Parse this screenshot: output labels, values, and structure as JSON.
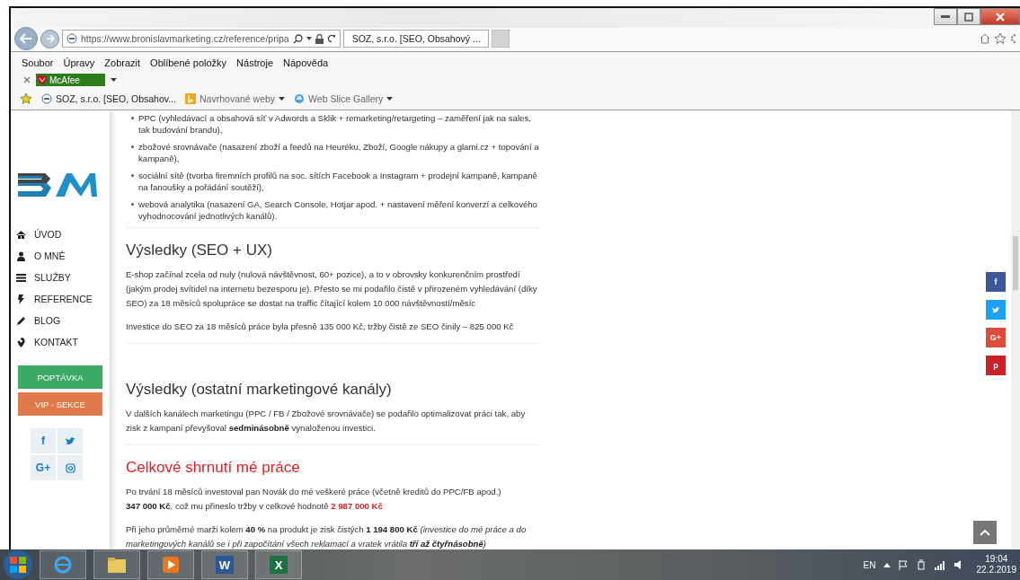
{
  "browser": {
    "url": "https://www.bronislavmarketing.cz/reference/pripa",
    "tab": {
      "title": "SOZ, s.r.o. [SEO, Obsahový ...",
      "selected": true
    },
    "menu": [
      "Soubor",
      "Úpravy",
      "Zobrazit",
      "Oblíbené položky",
      "Nástroje",
      "Nápověda"
    ],
    "toolbar_label": "McAfee",
    "favorites": [
      {
        "label": "SOZ, s.r.o. [SEO, Obsahov...",
        "kind": "site"
      },
      {
        "label": "Navrhované weby",
        "kind": "bing"
      },
      {
        "label": "Web Slice Gallery",
        "kind": "ie"
      }
    ]
  },
  "sidebar": {
    "nav": [
      {
        "label": "ÚVOD",
        "kind": "home"
      },
      {
        "label": "O MNĚ",
        "kind": "user"
      },
      {
        "label": "SLUŽBY",
        "kind": "list"
      },
      {
        "label": "REFERENCE",
        "kind": "bolt"
      },
      {
        "label": "BLOG",
        "kind": "pencil"
      },
      {
        "label": "KONTAKT",
        "kind": "pin"
      }
    ],
    "buttons": [
      {
        "label": "POPTÁVKA",
        "color": "#3aaa64"
      },
      {
        "label": "VIP - SEKCE",
        "color": "#e07a4a"
      }
    ],
    "social": [
      {
        "kind": "facebook",
        "glyph": "f"
      },
      {
        "kind": "twitter"
      },
      {
        "kind": "google",
        "glyph": "G+"
      },
      {
        "kind": "instagram"
      }
    ]
  },
  "content": [
    {
      "kind": "bullets",
      "items": [
        "PPC (vyhledávací a obsahová síť v Adwords a Sklik + remarketing/retargeting – zaměření jak na sales, tak budování brandu),",
        "zbožové srovnávače (nasazení zboží  a feedů na Heuréku, Zboží, Google nákupy a glami.cz + topování a kampaně),",
        "sociální sítě (tvorba firemních profilů na soc. sítích Facebook a Instagram + prodejní kampaně, kampaně na fanoušky a pořádání soutěží),",
        "webová analytika (nasazení GA, Search Console, Hotjar apod. + nastavení měření konverzí a celkového vyhodnocování jednotlivých kanálů)."
      ]
    },
    {
      "kind": "divider"
    },
    {
      "kind": "heading",
      "text": "Výsledky (SEO + UX)"
    },
    {
      "kind": "para",
      "text": "E-shop začínal zcela od nuly (nulová návštěvnost, 60+ pozice), a to v obrovsky konkurenčním prostředí (jakým prodej svítidel na internetu bezesporu je). Přesto se mi podařilo čistě v přirozeném vyhledávání (díky SEO) za 18 měsíců spolupráce se dostat na traffic čítající kolem 10 000 návštěvností/měsíc"
    },
    {
      "kind": "para",
      "text": "Investice do SEO za 18 měsíců práce byla přesně 135 000 Kč, tržby čistě ze SEO činily – 825 000 Kč"
    },
    {
      "kind": "divider"
    },
    {
      "kind": "spacer"
    },
    {
      "kind": "heading",
      "text": "Výsledky (ostatní marketingové kanály)"
    },
    {
      "kind": "para",
      "text": "V dalších kanálech marketingu (PPC / FB / Zbožové srovnávače) se podařilo optimalizovat práci tak, aby zisk z kampaní převyšoval **sedminásobně** vynaloženou investici."
    },
    {
      "kind": "divider"
    },
    {
      "kind": "heading-red",
      "text": "Celkové shrnutí mé práce"
    },
    {
      "kind": "para",
      "text": "Po trvání 18 měsíců investoval pan Novák do mé veškeré práce (včetně kreditů do PPC/FB apod.)\n**347 000 Kč**, což mu přineslo tržby v celkové hodnotě",
      "amount": "2 987 000 Kč"
    },
    {
      "kind": "para",
      "text": "Při jeho průměrné marži kolem **40 %** na produkt je zisk čistých **1 194 800 Kč**",
      "note": "(investice do mé práce a do marketingových kanálů se i při započítání všech reklamací a vratek vrátila **tří až čtyřnásobně**)"
    }
  ],
  "share": [
    {
      "kind": "facebook",
      "glyph": "f",
      "color": "#3b5998"
    },
    {
      "kind": "twitter",
      "color": "#1da1f2"
    },
    {
      "kind": "google",
      "glyph": "G+",
      "color": "#dd4b39"
    },
    {
      "kind": "pinterest",
      "glyph": "p",
      "color": "#cb2027"
    }
  ],
  "taskbar": {
    "apps": [
      {
        "kind": "ie"
      },
      {
        "kind": "folder"
      },
      {
        "kind": "media"
      },
      {
        "kind": "word",
        "glyph": "W"
      },
      {
        "kind": "excel",
        "glyph": "X"
      }
    ],
    "language": "EN",
    "time": "19:04",
    "date": "22.2.2019"
  }
}
